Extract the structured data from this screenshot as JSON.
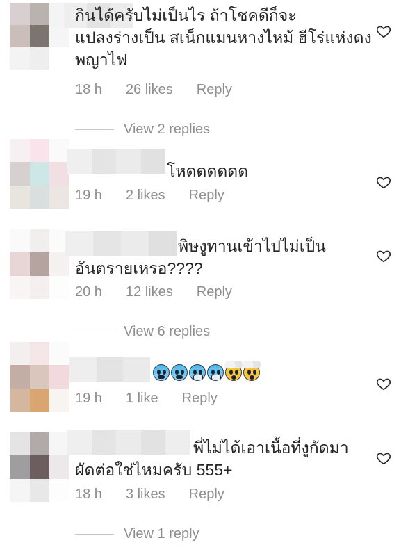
{
  "comments": [
    {
      "text": "กินได้ครับไม่เป็นไร ถ้าโชคดีก็จะ\nแปลงร่างเป็น สเน็กแมนหางไหม้ ฮีโร่แห่งดง\nพญาไฟ",
      "time": "18 h",
      "likes": "26 likes",
      "reply": "Reply",
      "view_replies": "View 2 replies"
    },
    {
      "text": "โหดดดดดด",
      "time": "19 h",
      "likes": "2 likes",
      "reply": "Reply"
    },
    {
      "text": "พิษงูทานเข้าไปไม่เป็น\nอันตรายเหรอ????",
      "time": "20 h",
      "likes": "12 likes",
      "reply": "Reply",
      "view_replies": "View 6 replies"
    },
    {
      "text": "",
      "emojis": [
        "anxious-face",
        "anxious-face",
        "cold-face",
        "cold-face",
        "exploding-head",
        "exploding-head"
      ],
      "time": "19 h",
      "likes": "1 like",
      "reply": "Reply"
    },
    {
      "text": "พี่ไม่ได้เอาเนื้อที่งูกัดมา\nผัดต่อใช่ไหมครับ 555+",
      "time": "18 h",
      "likes": "3 likes",
      "reply": "Reply",
      "view_replies": "View 1 reply"
    }
  ],
  "colors": {
    "text": "#262626",
    "muted": "#8e8e8e",
    "divider": "#c7c7c7",
    "heart_outline": "#262626"
  },
  "icons": {
    "like": "heart-outline-icon"
  }
}
